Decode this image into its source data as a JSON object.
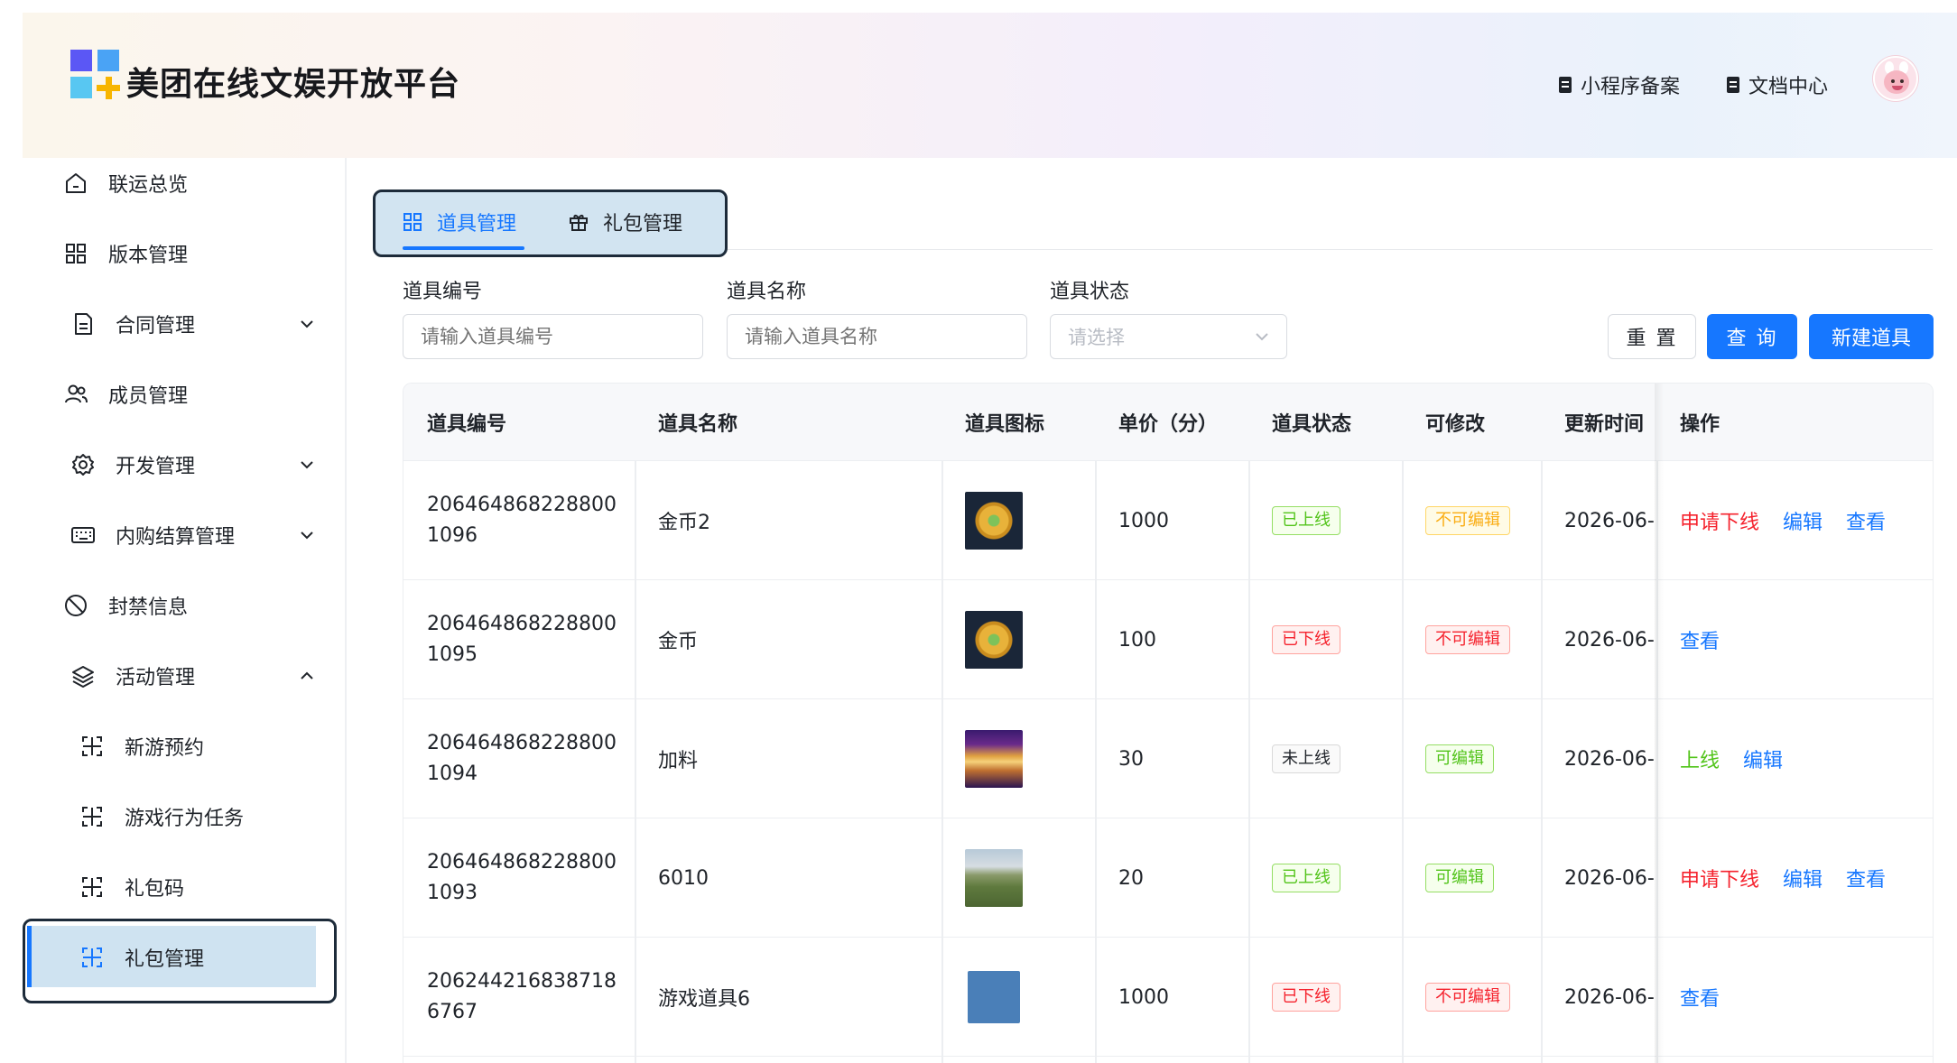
{
  "header": {
    "brand": "美团在线文娱开放平台",
    "links": [
      "小程序备案",
      "文档中心"
    ]
  },
  "sidebar": {
    "items": [
      {
        "label": "联运总览",
        "icon": "home-icon"
      },
      {
        "label": "版本管理",
        "icon": "grid-icon"
      },
      {
        "label": "合同管理",
        "icon": "document-icon",
        "expandable": true
      },
      {
        "label": "成员管理",
        "icon": "users-icon"
      },
      {
        "label": "开发管理",
        "icon": "gear-icon",
        "expandable": true
      },
      {
        "label": "内购结算管理",
        "icon": "keyboard-icon",
        "expandable": true
      },
      {
        "label": "封禁信息",
        "icon": "ban-icon"
      },
      {
        "label": "活动管理",
        "icon": "layers-icon",
        "expanded": true
      }
    ],
    "sub_items": [
      {
        "label": "新游预约"
      },
      {
        "label": "游戏行为任务"
      },
      {
        "label": "礼包码"
      },
      {
        "label": "礼包管理",
        "active": true
      }
    ]
  },
  "tabs": [
    {
      "label": "道具管理",
      "active": true
    },
    {
      "label": "礼包管理",
      "active": false
    }
  ],
  "filters": {
    "item_id": {
      "label": "道具编号",
      "placeholder": "请输入道具编号"
    },
    "item_name": {
      "label": "道具名称",
      "placeholder": "请输入道具名称"
    },
    "item_status": {
      "label": "道具状态",
      "placeholder": "请选择"
    }
  },
  "buttons": {
    "reset": "重 置",
    "query": "查 询",
    "new": "新建道具"
  },
  "table": {
    "columns": [
      "道具编号",
      "道具名称",
      "道具图标",
      "单价（分）",
      "道具状态",
      "可修改",
      "更新时间",
      "操作"
    ],
    "rows": [
      {
        "id": "206464868228800\n1096",
        "name": "金币2",
        "icon": "gold-coin",
        "price": "1000",
        "status": "已上线",
        "status_color": "green",
        "editable": "不可编辑",
        "editable_color": "gold",
        "time": "2026-06-",
        "actions": [
          {
            "label": "申请下线",
            "color": "red"
          },
          {
            "label": "编辑",
            "color": "blue"
          },
          {
            "label": "查看",
            "color": "blue"
          }
        ]
      },
      {
        "id": "206464868228800\n1095",
        "name": "金币",
        "icon": "gold-coin",
        "price": "100",
        "status": "已下线",
        "status_color": "red",
        "editable": "不可编辑",
        "editable_color": "red",
        "time": "2026-06-",
        "actions": [
          {
            "label": "查看",
            "color": "blue"
          }
        ]
      },
      {
        "id": "206464868228800\n1094",
        "name": "加料",
        "icon": "sunset-image",
        "price": "30",
        "status": "未上线",
        "status_color": "gray",
        "editable": "可编辑",
        "editable_color": "green",
        "time": "2026-06-",
        "actions": [
          {
            "label": "上线",
            "color": "green"
          },
          {
            "label": "编辑",
            "color": "blue"
          }
        ]
      },
      {
        "id": "206464868228800\n1093",
        "name": "6010",
        "icon": "landscape-image",
        "price": "20",
        "status": "已上线",
        "status_color": "green",
        "editable": "可编辑",
        "editable_color": "green",
        "time": "2026-06-",
        "actions": [
          {
            "label": "申请下线",
            "color": "red"
          },
          {
            "label": "编辑",
            "color": "blue"
          },
          {
            "label": "查看",
            "color": "blue"
          }
        ]
      },
      {
        "id": "206244216838718\n6767",
        "name": "游戏道具6",
        "icon": "blue-square",
        "price": "1000",
        "status": "已下线",
        "status_color": "red",
        "editable": "不可编辑",
        "editable_color": "red",
        "time": "2026-06-",
        "actions": [
          {
            "label": "查看",
            "color": "blue"
          }
        ]
      }
    ]
  }
}
